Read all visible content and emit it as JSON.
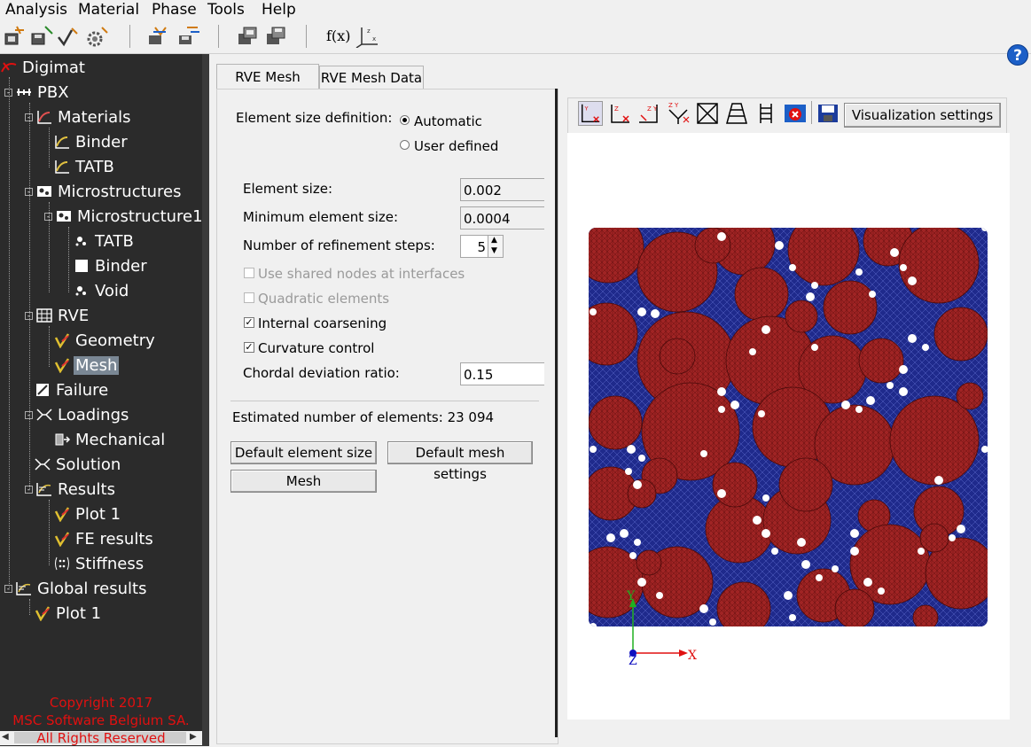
{
  "menu": [
    "Analysis",
    "Material",
    "Phase",
    "Tools",
    "Help"
  ],
  "toolbar_icons": [
    "new-analysis-icon",
    "save-analysis-icon",
    "check-analysis-icon",
    "settings-gear-icon",
    "export-icon",
    "import-icon",
    "copy-window-icon",
    "save-window-icon",
    "function-icon",
    "axes-icon"
  ],
  "toolbar_fx": "f(x)",
  "help_label": "?",
  "tree": {
    "root": "Digimat",
    "analysis": "PBX",
    "materials": "Materials",
    "material_items": [
      "Binder",
      "TATB"
    ],
    "microstructures": "Microstructures",
    "microstructure1": "Microstructure1",
    "phases": [
      "TATB",
      "Binder",
      "Void"
    ],
    "rve": "RVE",
    "rve_items": [
      "Geometry",
      "Mesh"
    ],
    "failure": "Failure",
    "loadings": "Loadings",
    "mechanical": "Mechanical",
    "solution": "Solution",
    "results": "Results",
    "result_items": [
      "Plot 1",
      "FE results",
      "Stiffness"
    ],
    "global_results": "Global results",
    "global_items": [
      "Plot 1"
    ]
  },
  "copyright": [
    "Copyright 2017",
    "MSC Software Belgium SA.",
    "All Rights Reserved"
  ],
  "tabs": [
    "RVE Mesh",
    "RVE Mesh Data"
  ],
  "form": {
    "size_def_label": "Element size definition:",
    "automatic": "Automatic",
    "user_defined": "User defined",
    "element_size_label": "Element size:",
    "element_size": "0.002",
    "min_size_label": "Minimum element size:",
    "min_size": "0.0004",
    "refine_label": "Number of refinement steps:",
    "refine": "5",
    "shared_nodes": "Use shared nodes at interfaces",
    "quadratic": "Quadratic elements",
    "internal_coarsening": "Internal coarsening",
    "curvature": "Curvature control",
    "chordal_label": "Chordal deviation ratio:",
    "chordal": "0.15",
    "estimated": "Estimated number of elements:  23 094",
    "default_size_btn": "Default element size",
    "default_mesh_btn": "Default mesh settings",
    "mesh_btn": "Mesh"
  },
  "viewer": {
    "tools": [
      "view-xy-icon",
      "view-zx-icon",
      "view-zy-icon",
      "view-iso-icon",
      "fit-icon",
      "perspective-icon",
      "ladder-icon",
      "close-red-icon",
      "save-icon"
    ],
    "vis_settings": "Visualization settings",
    "axis_x": "X",
    "axis_y": "Y",
    "axis_z": "Z",
    "colors": {
      "matrix": "#1f2a8c",
      "inclusion": "#a02424",
      "void": "#ffffff"
    }
  }
}
